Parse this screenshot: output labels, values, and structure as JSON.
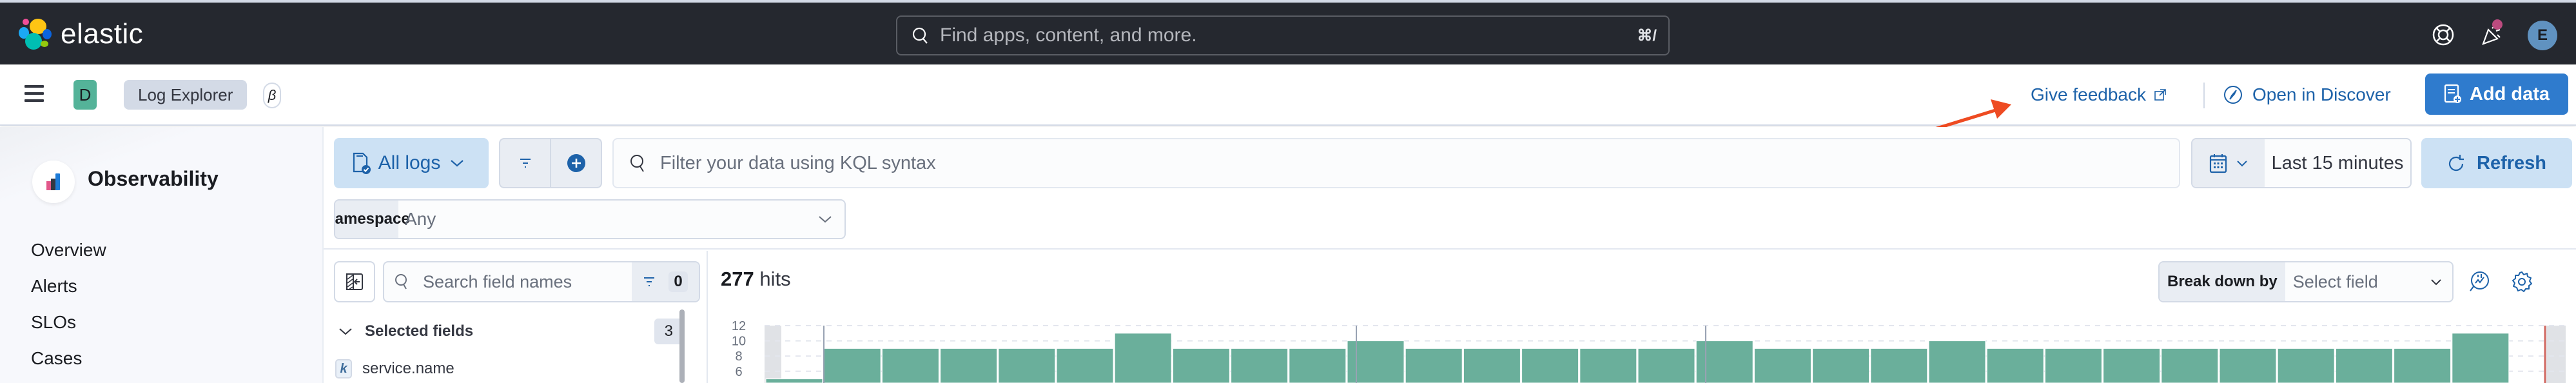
{
  "header": {
    "brand": "elastic",
    "search_placeholder": "Find apps, content, and more.",
    "search_shortcut": "⌘/",
    "user_initial": "E",
    "icons": [
      "help-icon",
      "newsfeed-icon"
    ]
  },
  "subheader": {
    "space_initial": "D",
    "breadcrumb": "Log Explorer",
    "beta_badge": "β",
    "give_feedback": "Give feedback",
    "open_in_discover": "Open in Discover",
    "add_data": "Add data"
  },
  "sidebar": {
    "title": "Observability",
    "items": [
      {
        "label": "Overview"
      },
      {
        "label": "Alerts"
      },
      {
        "label": "SLOs"
      },
      {
        "label": "Cases"
      }
    ]
  },
  "toolbar": {
    "dataset_selector": "All logs",
    "kql_placeholder": "Filter your data using KQL syntax",
    "time_range": "Last 15 minutes",
    "refresh": "Refresh",
    "namespace_label": "Namespace",
    "namespace_value": "Any"
  },
  "fields": {
    "search_placeholder": "Search field names",
    "filter_count": "0",
    "selected_title": "Selected fields",
    "selected_count": "3",
    "items": [
      {
        "type": "k",
        "name": "service.name"
      }
    ]
  },
  "histogram": {
    "hits_count": "277",
    "hits_label": "hits",
    "breakdown_label": "Break down by",
    "breakdown_placeholder": "Select field"
  },
  "colors": {
    "accent": "#1d62a9",
    "bar": "#6aaf9b",
    "primary_button": "#2f7bcd",
    "annotation_arrow": "#ee4b22"
  },
  "chart_data": {
    "type": "bar",
    "title": "",
    "xlabel": "",
    "ylabel": "",
    "ylim": [
      0,
      12
    ],
    "yticks": [
      6,
      8,
      10,
      12
    ],
    "grid": true,
    "values": [
      5,
      9,
      9,
      9,
      9,
      9,
      11,
      9,
      9,
      9,
      10,
      9,
      9,
      9,
      9,
      9,
      10,
      9,
      9,
      9,
      10,
      9,
      9,
      9,
      9,
      9,
      9,
      9,
      9,
      11
    ]
  }
}
